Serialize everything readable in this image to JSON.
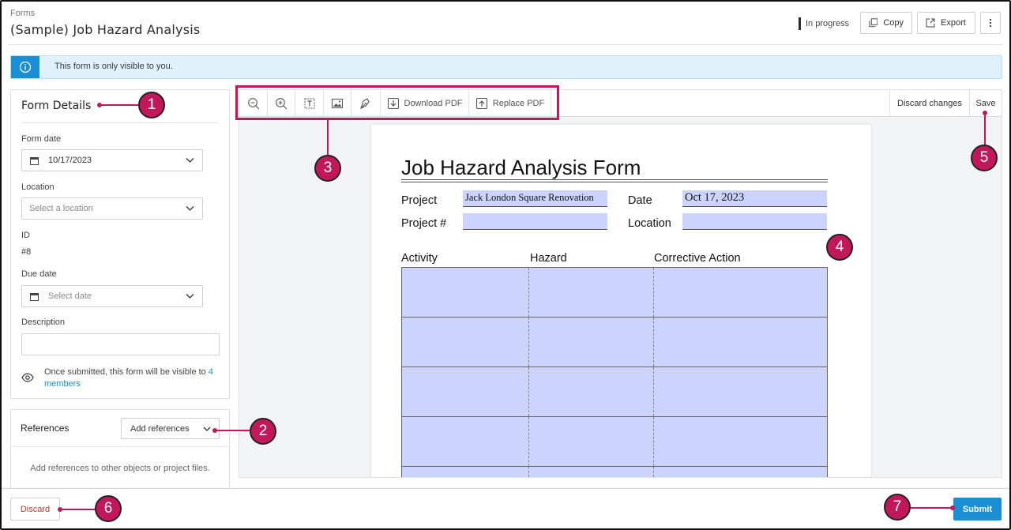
{
  "header": {
    "breadcrumb": "Forms",
    "title": "(Sample) Job Hazard Analysis",
    "status": "In progress",
    "copy_label": "Copy",
    "export_label": "Export"
  },
  "banner": {
    "text": "This form is only visible to you."
  },
  "form_details": {
    "title": "Form Details",
    "form_date_label": "Form date",
    "form_date_value": "10/17/2023",
    "location_label": "Location",
    "location_placeholder": "Select a location",
    "id_label": "ID",
    "id_value": "#8",
    "due_date_label": "Due date",
    "due_date_placeholder": "Select date",
    "description_label": "Description",
    "visibility_text": "Once submitted, this form will be visible to",
    "visibility_link": "4 members"
  },
  "references": {
    "title": "References",
    "add_label": "Add references",
    "empty_text": "Add references to other objects or project files."
  },
  "toolbar": {
    "download_label": "Download PDF",
    "replace_label": "Replace PDF",
    "discard_changes_label": "Discard changes",
    "save_label": "Save"
  },
  "pdf": {
    "title": "Job Hazard Analysis Form",
    "project_label": "Project",
    "project_value": "Jack London Square Renovation",
    "date_label": "Date",
    "date_value": "Oct 17, 2023",
    "project_num_label": "Project #",
    "location_label": "Location",
    "col_activity": "Activity",
    "col_hazard": "Hazard",
    "col_corrective": "Corrective Action"
  },
  "footer": {
    "discard_label": "Discard",
    "submit_label": "Submit"
  },
  "callouts": [
    "1",
    "2",
    "3",
    "4",
    "5",
    "6",
    "7"
  ],
  "colors": {
    "accent": "#1a8fd6",
    "callout": "#c2185b",
    "field_fill": "#ccd3fc"
  }
}
